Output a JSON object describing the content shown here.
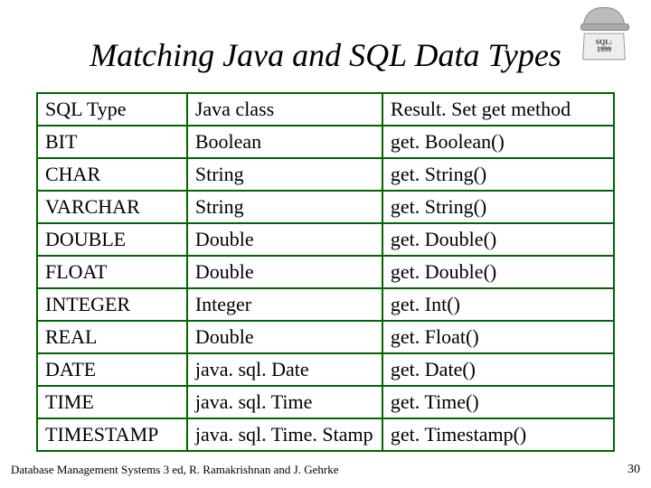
{
  "title": "Matching Java and SQL Data Types",
  "logo": {
    "line1": "SQL:",
    "line2": "1999"
  },
  "table": {
    "header": {
      "col1": "SQL Type",
      "col2": "Java class",
      "col3": "Result. Set get method"
    },
    "rows": [
      {
        "col1": "BIT",
        "col2": "Boolean",
        "col3": "get. Boolean()"
      },
      {
        "col1": "CHAR",
        "col2": "String",
        "col3": "get. String()"
      },
      {
        "col1": "VARCHAR",
        "col2": "String",
        "col3": "get. String()"
      },
      {
        "col1": "DOUBLE",
        "col2": "Double",
        "col3": "get. Double()"
      },
      {
        "col1": "FLOAT",
        "col2": "Double",
        "col3": "get. Double()"
      },
      {
        "col1": "INTEGER",
        "col2": "Integer",
        "col3": "get. Int()"
      },
      {
        "col1": "REAL",
        "col2": "Double",
        "col3": "get. Float()"
      },
      {
        "col1": "DATE",
        "col2": "java. sql. Date",
        "col3": "get. Date()"
      },
      {
        "col1": "TIME",
        "col2": "java. sql. Time",
        "col3": "get. Time()"
      },
      {
        "col1": "TIMESTAMP",
        "col2": "java. sql. Time. Stamp",
        "col3": "get. Timestamp()"
      }
    ]
  },
  "footer": "Database Management Systems 3 ed, R. Ramakrishnan and J. Gehrke",
  "page_number": "30",
  "chart_data": {
    "type": "table",
    "title": "Matching Java and SQL Data Types",
    "columns": [
      "SQL Type",
      "Java class",
      "ResultSet get method"
    ],
    "rows": [
      [
        "BIT",
        "Boolean",
        "getBoolean()"
      ],
      [
        "CHAR",
        "String",
        "getString()"
      ],
      [
        "VARCHAR",
        "String",
        "getString()"
      ],
      [
        "DOUBLE",
        "Double",
        "getDouble()"
      ],
      [
        "FLOAT",
        "Double",
        "getDouble()"
      ],
      [
        "INTEGER",
        "Integer",
        "getInt()"
      ],
      [
        "REAL",
        "Double",
        "getFloat()"
      ],
      [
        "DATE",
        "java.sql.Date",
        "getDate()"
      ],
      [
        "TIME",
        "java.sql.Time",
        "getTime()"
      ],
      [
        "TIMESTAMP",
        "java.sql.TimeStamp",
        "getTimestamp()"
      ]
    ]
  }
}
